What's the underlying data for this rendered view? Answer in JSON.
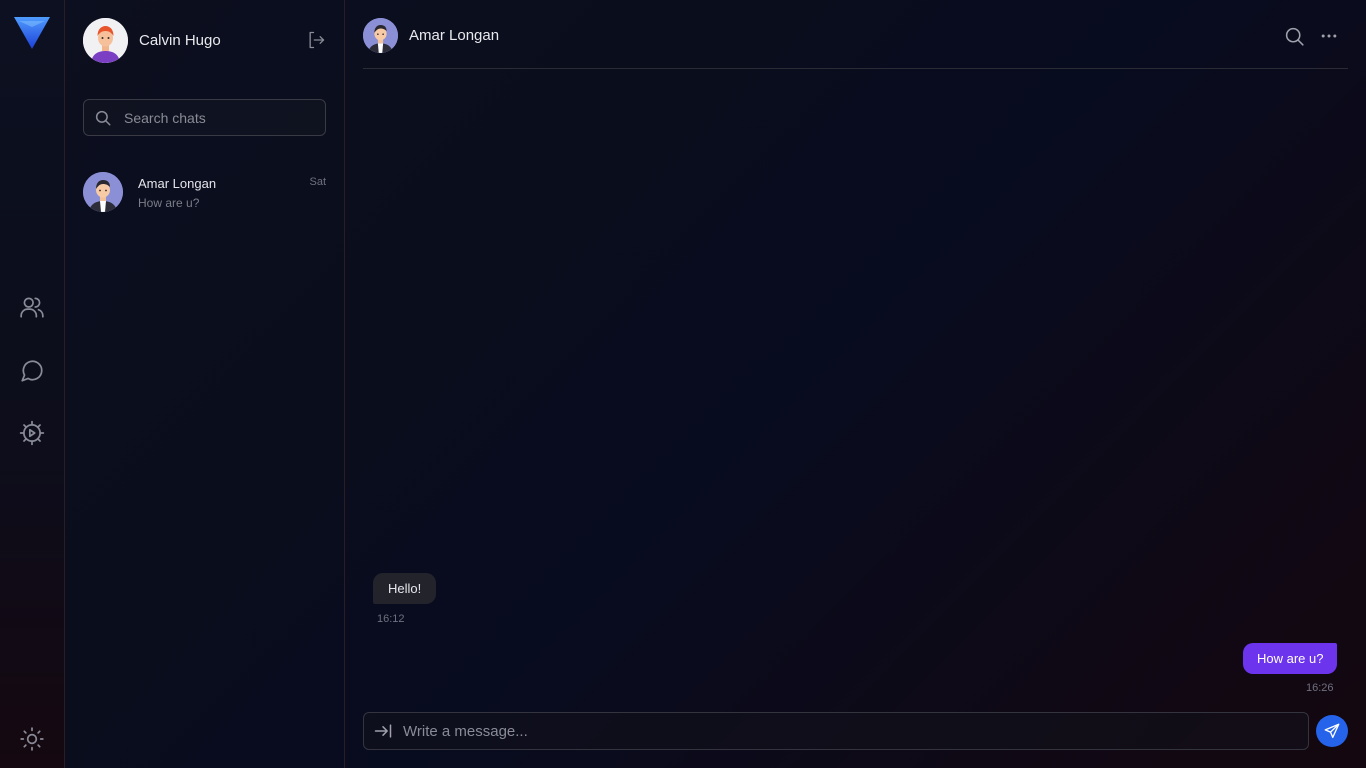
{
  "rail": {
    "items": [
      {
        "name": "contacts",
        "icon": "users-icon"
      },
      {
        "name": "chats",
        "icon": "chat-bubble-icon"
      },
      {
        "name": "settings",
        "icon": "settings-gear-icon"
      }
    ],
    "theme_icon": "sun-icon"
  },
  "sidebar": {
    "user_name": "Calvin Hugo",
    "search_placeholder": "Search chats",
    "chats": [
      {
        "name": "Amar Longan",
        "preview": "How are u?",
        "time": "Sat"
      }
    ]
  },
  "conversation": {
    "contact_name": "Amar Longan",
    "messages": [
      {
        "direction": "incoming",
        "text": "Hello!",
        "time": "16:12"
      },
      {
        "direction": "outgoing",
        "text": "How are u?",
        "time": "16:26"
      }
    ],
    "composer_placeholder": "Write a message..."
  },
  "colors": {
    "accent_purple": "#6d34ee",
    "send_blue": "#2563eb",
    "logo_blue": "#1d4ed8"
  }
}
